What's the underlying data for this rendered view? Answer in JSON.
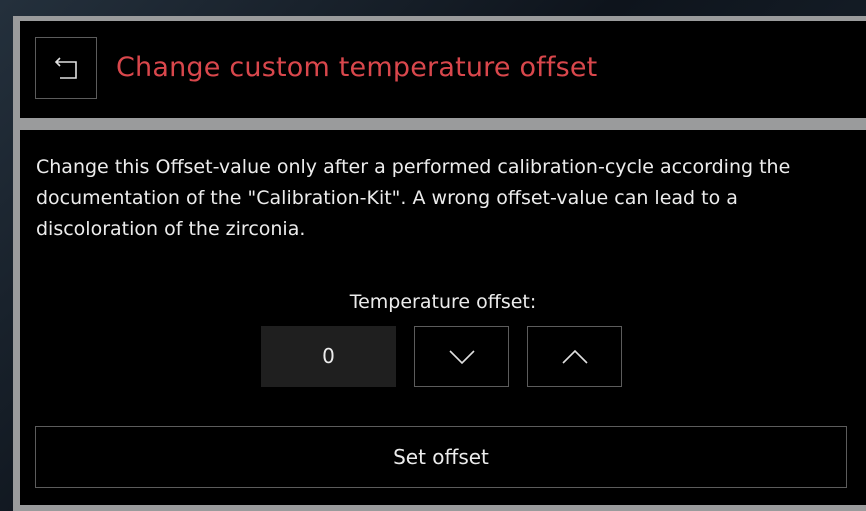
{
  "header": {
    "back_icon": "back-arrow-icon",
    "title": "Change custom temperature offset",
    "title_color": "#d9474c"
  },
  "main": {
    "message": "Change this Offset-value only after a performed calibration-cycle according the documentation of the \"Calibration-Kit\". A wrong offset-value can lead to a discoloration of the zirconia.",
    "offset_label": "Temperature offset:",
    "offset_value": "0",
    "decrease_icon": "chevron-down-icon",
    "increase_icon": "chevron-up-icon",
    "set_button_label": "Set offset"
  }
}
